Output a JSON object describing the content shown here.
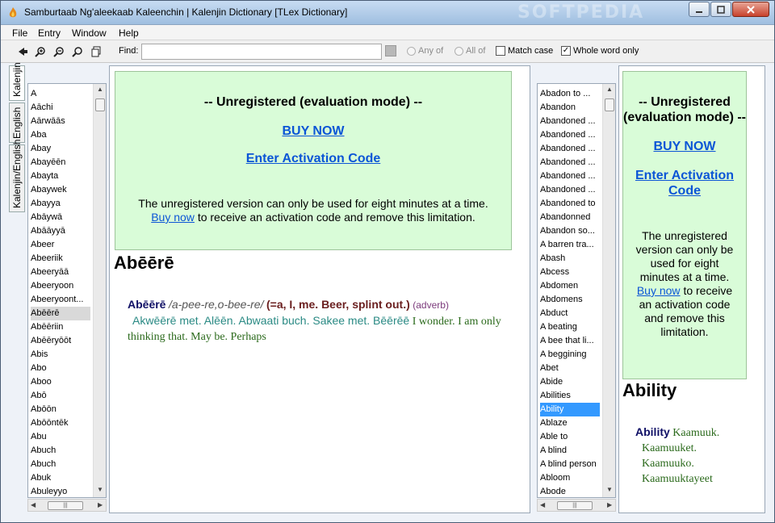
{
  "window": {
    "title": "Samburtaab Ng'aleekaab Kaleenchin | Kalenjin Dictionary [TLex Dictionary]",
    "watermark": "SOFTPEDIA"
  },
  "menu": [
    "File",
    "Entry",
    "Window",
    "Help"
  ],
  "toolbar": {
    "find_label": "Find:",
    "find_value": "",
    "any_of": "Any of",
    "all_of": "All of",
    "match_case": "Match case",
    "match_case_checked": false,
    "whole_word": "Whole word only",
    "whole_word_checked": true
  },
  "tabs": [
    "Kalenjin",
    "English",
    "Kalenjin/English"
  ],
  "left_list": {
    "items": [
      "A",
      "Aāchi",
      "Aārwāās",
      "Aba",
      "Abay",
      "Abayēēn",
      "Abayta",
      "Abaywek",
      "Abayya",
      "Abāywā",
      "Abāāyyā",
      "Abeer",
      "Abeeriik",
      "Abeeryāā",
      "Abeeryoon",
      "Abeeryoont...",
      "Abēērē",
      "Abēēriin",
      "Abēēryōōt",
      "Abis",
      "Abo",
      "Aboo",
      "Abō",
      "Abōōn",
      "Abōōntēk",
      "Abu",
      "Abuch",
      "Abuch",
      "Abuk",
      "Abuleyyo"
    ],
    "selected_index": 16
  },
  "promo": {
    "heading": "-- Unregistered (evaluation mode) --",
    "buy_now": "BUY NOW",
    "enter_code": "Enter Activation Code",
    "body_1": "The unregistered version can only be used for eight minutes at a time.",
    "body_link": "Buy now",
    "body_2": "to receive an activation code and remove this limitation."
  },
  "left_entry": {
    "title": "Abēērē",
    "headword": "Abēērē",
    "pronunciation": "/a-pee-re,o-bee-re/",
    "grammar": "(=a, I, me. Beer, splint out.)",
    "pos": "(adverb)",
    "teal_text": "Akwēērē met. Alēēn. Abwaati buch. Sakee met. Bēērēē",
    "green_text": "I wonder. I am only thinking that. May be. Perhaps"
  },
  "right_list": {
    "items": [
      "Abadon to ...",
      "Abandon",
      "Abandoned ...",
      "Abandoned ...",
      "Abandoned ...",
      "Abandoned ...",
      "Abandoned ...",
      "Abandoned ...",
      "Abandoned to",
      "Abandonned",
      "Abandon so...",
      "A barren tra...",
      "Abash",
      "Abcess",
      "Abdomen",
      "Abdomens",
      "Abduct",
      "A beating",
      "A bee that li...",
      "A beggining",
      "Abet",
      "Abide",
      "Abilities",
      "Ability",
      "Ablaze",
      "Able to",
      "A blind",
      "A blind person",
      "Abloom",
      "Abode"
    ],
    "selected_index": 23
  },
  "right_entry": {
    "title": "Ability",
    "headword": "Ability",
    "line1": "Kaamuuk.",
    "line2": "Kaamuuket.",
    "line3": "Kaamuuko.",
    "line4": "Kaamuuktayeet"
  }
}
